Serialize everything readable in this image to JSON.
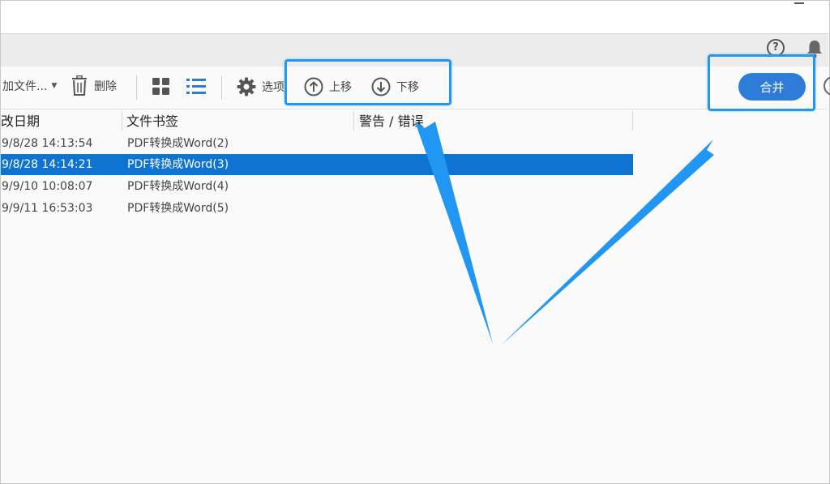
{
  "toolbar": {
    "add_files_label": "加文件...",
    "delete_label": "删除",
    "options_label": "选项",
    "move_up_label": "上移",
    "move_down_label": "下移",
    "merge_label": "合并",
    "help_symbol": "?"
  },
  "table": {
    "columns": [
      "改日期",
      "文件书签",
      "警告 / 错误"
    ],
    "rows": [
      {
        "date": "9/8/28 14:13:54",
        "bookmark": "PDF转换成Word(2)",
        "selected": false
      },
      {
        "date": "9/8/28 14:14:21",
        "bookmark": "PDF转换成Word(3)",
        "selected": true
      },
      {
        "date": "9/9/10 10:08:07",
        "bookmark": "PDF转换成Word(4)",
        "selected": false
      },
      {
        "date": "9/9/11 16:53:03",
        "bookmark": "PDF转换成Word(5)",
        "selected": false
      }
    ]
  },
  "icons": {
    "help": "help-icon",
    "notifications": "bell-icon",
    "delete": "trash-icon",
    "grid_view": "grid-view-icon",
    "list_view": "list-view-icon",
    "options": "gear-icon",
    "move_up": "arrow-up-circle-icon",
    "move_down": "arrow-down-circle-icon"
  },
  "colors": {
    "accent": "#2e7bd8",
    "selected_row": "#0f73d1",
    "annotation": "#2196f3"
  }
}
